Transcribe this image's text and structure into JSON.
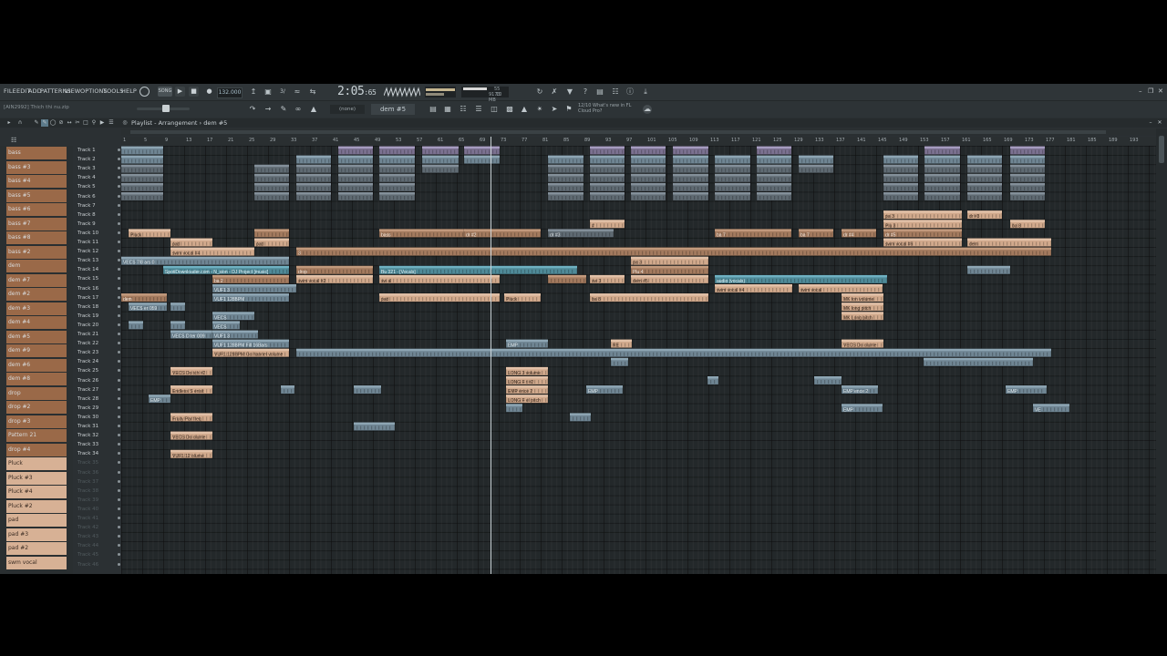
{
  "menu": [
    "FILE",
    "EDIT",
    "ADD",
    "PATTERNS",
    "VIEW",
    "OPTIONS",
    "TOOLS",
    "HELP"
  ],
  "transport": {
    "tempo": "132.000",
    "time_main": "2:05",
    "time_sub": ":65",
    "cpu_mem": "9173 MB",
    "cpu_val": "55",
    "cpu_poly": "10"
  },
  "toolbar": {
    "hint": "[AIN2992] Thich thi nu.zip",
    "snap": "(none)",
    "pattern": "dem #5",
    "news": "12/10  What's new in FL Cloud Pro?"
  },
  "playlist": {
    "title": "Playlist - Arrangement › dem #5",
    "bars": [
      "1",
      "5",
      "9",
      "13",
      "17",
      "21",
      "25",
      "29",
      "33",
      "37",
      "41",
      "45",
      "49",
      "53",
      "57",
      "61",
      "65",
      "69",
      "73",
      "77",
      "81",
      "85",
      "89",
      "93",
      "97",
      "101",
      "105",
      "109",
      "113",
      "117",
      "121",
      "125",
      "129",
      "133",
      "137",
      "141",
      "145",
      "149",
      "153",
      "157",
      "161",
      "165",
      "169",
      "173",
      "177",
      "181",
      "185",
      "189",
      "193"
    ]
  },
  "picker": [
    {
      "label": "bass",
      "c": "a"
    },
    {
      "label": "bass #3",
      "c": "a"
    },
    {
      "label": "bass #4",
      "c": "a"
    },
    {
      "label": "bass #5",
      "c": "a"
    },
    {
      "label": "bass #6",
      "c": "a"
    },
    {
      "label": "bass #7",
      "c": "a"
    },
    {
      "label": "bass #8",
      "c": "a"
    },
    {
      "label": "bass #2",
      "c": "a"
    },
    {
      "label": "dem",
      "c": "a"
    },
    {
      "label": "dem #7",
      "c": "a"
    },
    {
      "label": "dem #2",
      "c": "a"
    },
    {
      "label": "dem #3",
      "c": "a"
    },
    {
      "label": "dem #4",
      "c": "a"
    },
    {
      "label": "dem #5",
      "c": "a"
    },
    {
      "label": "dem #9",
      "c": "a"
    },
    {
      "label": "dem #6",
      "c": "a"
    },
    {
      "label": "dem #8",
      "c": "a"
    },
    {
      "label": "drop",
      "c": "a"
    },
    {
      "label": "drop #2",
      "c": "a"
    },
    {
      "label": "drop #3",
      "c": "a"
    },
    {
      "label": "Pattern 21",
      "c": "a"
    },
    {
      "label": "drop #4",
      "c": "a"
    },
    {
      "label": "Pluck",
      "c": "b"
    },
    {
      "label": "Pluck #3",
      "c": "b"
    },
    {
      "label": "Pluck #4",
      "c": "b"
    },
    {
      "label": "Pluck #2",
      "c": "b"
    },
    {
      "label": "pad",
      "c": "b"
    },
    {
      "label": "pad #3",
      "c": "b"
    },
    {
      "label": "pad #2",
      "c": "b"
    },
    {
      "label": "swm vocal",
      "c": "b"
    }
  ],
  "tracks": [
    "Track 1",
    "Track 2",
    "Track 3",
    "Track 4",
    "Track 5",
    "Track 6",
    "Track 7",
    "Track 8",
    "Track 9",
    "Track 10",
    "Track 11",
    "Track 12",
    "Track 13",
    "Track 14",
    "Track 15",
    "Track 16",
    "Track 17",
    "Track 18",
    "Track 19",
    "Track 20",
    "Track 21",
    "Track 22",
    "Track 23",
    "Track 24",
    "Track 25",
    "Track 26",
    "Track 27",
    "Track 28",
    "Track 29",
    "Track 30",
    "Track 31",
    "Track 32",
    "Track 33",
    "Track 34",
    "Track 35",
    "Track 36",
    "Track 37",
    "Track 38",
    "Track 39",
    "Track 40",
    "Track 41",
    "Track 42",
    "Track 43",
    "Track 44",
    "Track 45",
    "Track 46"
  ],
  "active_track_count": 34,
  "clips": [
    {
      "t": 0,
      "s": 0,
      "e": 46,
      "k": "blue"
    },
    {
      "t": 0,
      "s": 238,
      "e": 276,
      "k": "purple"
    },
    {
      "t": 0,
      "s": 283,
      "e": 322,
      "k": "purple"
    },
    {
      "t": 0,
      "s": 330,
      "e": 370,
      "k": "purple"
    },
    {
      "t": 0,
      "s": 376,
      "e": 415,
      "k": "purple"
    },
    {
      "t": 0,
      "s": 514,
      "e": 552,
      "k": "purple"
    },
    {
      "t": 0,
      "s": 559,
      "e": 597,
      "k": "purple"
    },
    {
      "t": 0,
      "s": 605,
      "e": 644,
      "k": "purple"
    },
    {
      "t": 0,
      "s": 697,
      "e": 735,
      "k": "purple"
    },
    {
      "t": 0,
      "s": 881,
      "e": 920,
      "k": "purple"
    },
    {
      "t": 0,
      "s": 975,
      "e": 1013,
      "k": "purple"
    },
    {
      "t": 1,
      "s": 0,
      "e": 46,
      "k": "blue"
    },
    {
      "t": 1,
      "s": 192,
      "e": 230,
      "k": "blue"
    },
    {
      "t": 1,
      "s": 238,
      "e": 276,
      "k": "blue"
    },
    {
      "t": 1,
      "s": 283,
      "e": 322,
      "k": "blue"
    },
    {
      "t": 1,
      "s": 330,
      "e": 370,
      "k": "blue"
    },
    {
      "t": 1,
      "s": 376,
      "e": 415,
      "k": "blue"
    },
    {
      "t": 1,
      "s": 468,
      "e": 507,
      "k": "blue"
    },
    {
      "t": 1,
      "s": 514,
      "e": 552,
      "k": "blue"
    },
    {
      "t": 1,
      "s": 559,
      "e": 597,
      "k": "blue"
    },
    {
      "t": 1,
      "s": 605,
      "e": 644,
      "k": "blue"
    },
    {
      "t": 1,
      "s": 651,
      "e": 690,
      "k": "blue"
    },
    {
      "t": 1,
      "s": 697,
      "e": 735,
      "k": "blue"
    },
    {
      "t": 1,
      "s": 743,
      "e": 781,
      "k": "blue"
    },
    {
      "t": 1,
      "s": 836,
      "e": 874,
      "k": "blue"
    },
    {
      "t": 1,
      "s": 881,
      "e": 920,
      "k": "blue"
    },
    {
      "t": 1,
      "s": 928,
      "e": 966,
      "k": "blue"
    },
    {
      "t": 1,
      "s": 975,
      "e": 1013,
      "k": "blue"
    },
    {
      "t": 2,
      "s": 0,
      "e": 46,
      "k": "grey"
    },
    {
      "t": 2,
      "s": 146,
      "e": 184,
      "k": "grey"
    },
    {
      "t": 2,
      "s": 192,
      "e": 230,
      "k": "grey"
    },
    {
      "t": 2,
      "s": 238,
      "e": 276,
      "k": "grey"
    },
    {
      "t": 2,
      "s": 283,
      "e": 322,
      "k": "grey"
    },
    {
      "t": 2,
      "s": 330,
      "e": 370,
      "k": "grey"
    },
    {
      "t": 2,
      "s": 468,
      "e": 507,
      "k": "grey"
    },
    {
      "t": 2,
      "s": 514,
      "e": 552,
      "k": "grey"
    },
    {
      "t": 2,
      "s": 559,
      "e": 597,
      "k": "grey"
    },
    {
      "t": 2,
      "s": 605,
      "e": 644,
      "k": "grey"
    },
    {
      "t": 2,
      "s": 651,
      "e": 690,
      "k": "grey"
    },
    {
      "t": 2,
      "s": 697,
      "e": 735,
      "k": "grey"
    },
    {
      "t": 2,
      "s": 743,
      "e": 781,
      "k": "grey"
    },
    {
      "t": 2,
      "s": 836,
      "e": 874,
      "k": "grey"
    },
    {
      "t": 2,
      "s": 881,
      "e": 920,
      "k": "grey"
    },
    {
      "t": 2,
      "s": 928,
      "e": 966,
      "k": "grey"
    },
    {
      "t": 2,
      "s": 975,
      "e": 1013,
      "k": "grey"
    },
    {
      "t": 3,
      "s": 0,
      "e": 46,
      "k": "grey"
    },
    {
      "t": 3,
      "s": 146,
      "e": 184,
      "k": "grey"
    },
    {
      "t": 3,
      "s": 192,
      "e": 230,
      "k": "grey"
    },
    {
      "t": 3,
      "s": 238,
      "e": 276,
      "k": "grey"
    },
    {
      "t": 3,
      "s": 283,
      "e": 322,
      "k": "grey"
    },
    {
      "t": 3,
      "s": 468,
      "e": 507,
      "k": "grey"
    },
    {
      "t": 3,
      "s": 514,
      "e": 552,
      "k": "grey"
    },
    {
      "t": 3,
      "s": 559,
      "e": 597,
      "k": "grey"
    },
    {
      "t": 3,
      "s": 605,
      "e": 644,
      "k": "grey"
    },
    {
      "t": 3,
      "s": 651,
      "e": 690,
      "k": "grey"
    },
    {
      "t": 3,
      "s": 697,
      "e": 735,
      "k": "grey"
    },
    {
      "t": 3,
      "s": 836,
      "e": 874,
      "k": "grey"
    },
    {
      "t": 3,
      "s": 881,
      "e": 920,
      "k": "grey"
    },
    {
      "t": 3,
      "s": 928,
      "e": 966,
      "k": "grey"
    },
    {
      "t": 3,
      "s": 975,
      "e": 1013,
      "k": "grey"
    },
    {
      "t": 4,
      "s": 0,
      "e": 46,
      "k": "grey"
    },
    {
      "t": 4,
      "s": 146,
      "e": 184,
      "k": "grey"
    },
    {
      "t": 4,
      "s": 192,
      "e": 230,
      "k": "grey"
    },
    {
      "t": 4,
      "s": 238,
      "e": 276,
      "k": "grey"
    },
    {
      "t": 4,
      "s": 283,
      "e": 322,
      "k": "grey"
    },
    {
      "t": 4,
      "s": 468,
      "e": 507,
      "k": "grey"
    },
    {
      "t": 4,
      "s": 514,
      "e": 552,
      "k": "grey"
    },
    {
      "t": 4,
      "s": 559,
      "e": 597,
      "k": "grey"
    },
    {
      "t": 4,
      "s": 605,
      "e": 644,
      "k": "grey"
    },
    {
      "t": 4,
      "s": 651,
      "e": 690,
      "k": "grey"
    },
    {
      "t": 4,
      "s": 697,
      "e": 735,
      "k": "grey"
    },
    {
      "t": 4,
      "s": 836,
      "e": 874,
      "k": "grey"
    },
    {
      "t": 4,
      "s": 881,
      "e": 920,
      "k": "grey"
    },
    {
      "t": 4,
      "s": 928,
      "e": 966,
      "k": "grey"
    },
    {
      "t": 4,
      "s": 975,
      "e": 1013,
      "k": "grey"
    },
    {
      "t": 5,
      "s": 0,
      "e": 46,
      "k": "grey"
    },
    {
      "t": 5,
      "s": 146,
      "e": 184,
      "k": "grey"
    },
    {
      "t": 5,
      "s": 192,
      "e": 230,
      "k": "grey"
    },
    {
      "t": 5,
      "s": 238,
      "e": 276,
      "k": "grey"
    },
    {
      "t": 5,
      "s": 283,
      "e": 322,
      "k": "grey"
    },
    {
      "t": 5,
      "s": 468,
      "e": 507,
      "k": "grey"
    },
    {
      "t": 5,
      "s": 514,
      "e": 552,
      "k": "grey"
    },
    {
      "t": 5,
      "s": 559,
      "e": 597,
      "k": "grey"
    },
    {
      "t": 5,
      "s": 605,
      "e": 644,
      "k": "grey"
    },
    {
      "t": 5,
      "s": 651,
      "e": 690,
      "k": "grey"
    },
    {
      "t": 5,
      "s": 697,
      "e": 735,
      "k": "grey"
    },
    {
      "t": 5,
      "s": 836,
      "e": 874,
      "k": "grey"
    },
    {
      "t": 5,
      "s": 881,
      "e": 920,
      "k": "grey"
    },
    {
      "t": 5,
      "s": 928,
      "e": 966,
      "k": "grey"
    },
    {
      "t": 5,
      "s": 975,
      "e": 1013,
      "k": "grey"
    },
    {
      "t": 7,
      "s": 836,
      "e": 922,
      "k": "peach",
      "n": "pa 3"
    },
    {
      "t": 7,
      "s": 928,
      "e": 966,
      "k": "peach",
      "n": "dr #3"
    },
    {
      "t": 8,
      "s": 514,
      "e": 552,
      "k": "peach",
      "n": "#"
    },
    {
      "t": 8,
      "s": 836,
      "e": 922,
      "k": "peach",
      "n": "Plu 3"
    },
    {
      "t": 8,
      "s": 975,
      "e": 1013,
      "k": "peach",
      "n": "ba 8"
    },
    {
      "t": 9,
      "s": 8,
      "e": 54,
      "k": "peach",
      "n": "Pluck"
    },
    {
      "t": 9,
      "s": 146,
      "e": 184,
      "k": "brown"
    },
    {
      "t": 9,
      "s": 283,
      "e": 378,
      "k": "brown",
      "n": "bass"
    },
    {
      "t": 9,
      "s": 376,
      "e": 460,
      "k": "brown",
      "n": "dr #2"
    },
    {
      "t": 9,
      "s": 468,
      "e": 540,
      "k": "grey",
      "n": "dr #3"
    },
    {
      "t": 9,
      "s": 651,
      "e": 735,
      "k": "brown",
      "n": "ba 7"
    },
    {
      "t": 9,
      "s": 743,
      "e": 781,
      "k": "brown",
      "n": "ba 7"
    },
    {
      "t": 9,
      "s": 790,
      "e": 828,
      "k": "brown",
      "n": "dr #4"
    },
    {
      "t": 9,
      "s": 836,
      "e": 922,
      "k": "brown",
      "n": "dr #5"
    },
    {
      "t": 10,
      "s": 54,
      "e": 100,
      "k": "peach",
      "n": "pad"
    },
    {
      "t": 10,
      "s": 146,
      "e": 184,
      "k": "peach",
      "n": "pad"
    },
    {
      "t": 10,
      "s": 836,
      "e": 922,
      "k": "peach",
      "n": "swm vocal #6"
    },
    {
      "t": 10,
      "s": 928,
      "e": 1020,
      "k": "peach",
      "n": "dem"
    },
    {
      "t": 11,
      "s": 54,
      "e": 146,
      "k": "peach",
      "n": "swm vocal #4"
    },
    {
      "t": 11,
      "s": 192,
      "e": 1020,
      "k": "brown",
      "n": "3"
    },
    {
      "t": 12,
      "s": 0,
      "e": 184,
      "k": "blue",
      "n": "VECS 7/8 ars 0"
    },
    {
      "t": 12,
      "s": 559,
      "e": 644,
      "k": "peach",
      "n": "pa 3"
    },
    {
      "t": 13,
      "s": 46,
      "e": 184,
      "k": "teal",
      "n": "SpotiDownloader.com - N_sion - DJ Project [music]"
    },
    {
      "t": 13,
      "s": 192,
      "e": 276,
      "k": "brown",
      "n": "drop"
    },
    {
      "t": 13,
      "s": 283,
      "e": 500,
      "k": "teal",
      "n": "Bu 321 - [Vocals]"
    },
    {
      "t": 13,
      "s": 559,
      "e": 644,
      "k": "brown",
      "n": "Plu 4"
    },
    {
      "t": 13,
      "s": 928,
      "e": 975,
      "k": "blue"
    },
    {
      "t": 14,
      "s": 100,
      "e": 184,
      "k": "brown",
      "n": "ba 2"
    },
    {
      "t": 14,
      "s": 192,
      "e": 276,
      "k": "peach",
      "n": "swm vocal #2"
    },
    {
      "t": 14,
      "s": 283,
      "e": 415,
      "k": "peach",
      "n": "sw al"
    },
    {
      "t": 14,
      "s": 468,
      "e": 510,
      "k": "brown"
    },
    {
      "t": 14,
      "s": 514,
      "e": 552,
      "k": "peach",
      "n": "sw 3"
    },
    {
      "t": 14,
      "s": 559,
      "e": 644,
      "k": "peach",
      "n": "dem #5"
    },
    {
      "t": 14,
      "s": 651,
      "e": 840,
      "k": "teal",
      "n": "audio (vocals)"
    },
    {
      "t": 15,
      "s": 100,
      "e": 192,
      "k": "blue",
      "n": "VUF1 3"
    },
    {
      "t": 15,
      "s": 651,
      "e": 736,
      "k": "peach",
      "n": "swm vocal #4"
    },
    {
      "t": 15,
      "s": 743,
      "e": 835,
      "k": "peach",
      "n": "swm vocal"
    },
    {
      "t": 16,
      "s": 0,
      "e": 50,
      "k": "brown",
      "n": "dem"
    },
    {
      "t": 16,
      "s": 100,
      "e": 184,
      "k": "blue",
      "n": "VUF1 128BPM"
    },
    {
      "t": 16,
      "s": 283,
      "e": 415,
      "k": "peach",
      "n": "pad"
    },
    {
      "t": 16,
      "s": 420,
      "e": 460,
      "k": "peach",
      "n": "Pluck"
    },
    {
      "t": 16,
      "s": 514,
      "e": 644,
      "k": "peach",
      "n": "ba 8"
    },
    {
      "t": 16,
      "s": 790,
      "e": 836,
      "k": "peach",
      "n": "MK ton volume"
    },
    {
      "t": 17,
      "s": 8,
      "e": 50,
      "k": "blue",
      "n": "VECS er 059"
    },
    {
      "t": 17,
      "s": 54,
      "e": 70,
      "k": "blue"
    },
    {
      "t": 17,
      "s": 790,
      "e": 836,
      "k": "peach",
      "n": "MK long pitch"
    },
    {
      "t": 18,
      "s": 100,
      "e": 146,
      "k": "blue",
      "n": "VECS"
    },
    {
      "t": 18,
      "s": 790,
      "e": 836,
      "k": "peach",
      "n": "MK Long pitch"
    },
    {
      "t": 19,
      "s": 8,
      "e": 24,
      "k": "blue"
    },
    {
      "t": 19,
      "s": 54,
      "e": 70,
      "k": "blue"
    },
    {
      "t": 19,
      "s": 100,
      "e": 130,
      "k": "blue",
      "n": "VECS"
    },
    {
      "t": 20,
      "s": 54,
      "e": 100,
      "k": "blue",
      "n": "VECS D ter 009"
    },
    {
      "t": 20,
      "s": 100,
      "e": 150,
      "k": "blue",
      "n": "VUF1 3"
    },
    {
      "t": 21,
      "s": 100,
      "e": 184,
      "k": "blue",
      "n": "VUF1 128BPM Fill 16Bars"
    },
    {
      "t": 21,
      "s": 422,
      "e": 468,
      "k": "blue",
      "n": "EMP"
    },
    {
      "t": 21,
      "s": 537,
      "e": 560,
      "k": "peach",
      "n": "RE"
    },
    {
      "t": 21,
      "s": 790,
      "e": 836,
      "k": "peach",
      "n": "VECS Do olume"
    },
    {
      "t": 22,
      "s": 100,
      "e": 184,
      "k": "peach",
      "n": "VUF1 128BPM Go hannel volume"
    },
    {
      "t": 22,
      "s": 192,
      "e": 1020,
      "k": "blue"
    },
    {
      "t": 23,
      "s": 537,
      "e": 556,
      "k": "blue"
    },
    {
      "t": 23,
      "s": 880,
      "e": 1000,
      "k": "blue"
    },
    {
      "t": 24,
      "s": 54,
      "e": 100,
      "k": "peach",
      "n": "VECS Do tch #2"
    },
    {
      "t": 24,
      "s": 422,
      "e": 468,
      "k": "peach",
      "n": "LONG 3 volume"
    },
    {
      "t": 25,
      "s": 422,
      "e": 468,
      "k": "peach",
      "n": "LONG F t #2"
    },
    {
      "t": 25,
      "s": 643,
      "e": 655,
      "k": "blue"
    },
    {
      "t": 25,
      "s": 760,
      "e": 790,
      "k": "blue"
    },
    {
      "t": 26,
      "s": 54,
      "e": 100,
      "k": "peach",
      "n": "Endless S ensit"
    },
    {
      "t": 26,
      "s": 175,
      "e": 190,
      "k": "blue"
    },
    {
      "t": 26,
      "s": 255,
      "e": 285,
      "k": "blue"
    },
    {
      "t": 26,
      "s": 422,
      "e": 468,
      "k": "peach",
      "n": "EMP ence 2"
    },
    {
      "t": 26,
      "s": 510,
      "e": 550,
      "k": "blue",
      "n": "EMP"
    },
    {
      "t": 26,
      "s": 790,
      "e": 830,
      "k": "blue",
      "n": "EMP ence 2"
    },
    {
      "t": 26,
      "s": 970,
      "e": 1015,
      "k": "blue",
      "n": "EMP"
    },
    {
      "t": 27,
      "s": 30,
      "e": 54,
      "k": "blue",
      "n": "EMP"
    },
    {
      "t": 27,
      "s": 422,
      "e": 468,
      "k": "peach",
      "n": "LONG F el pitch"
    },
    {
      "t": 28,
      "s": 422,
      "e": 440,
      "k": "blue"
    },
    {
      "t": 28,
      "s": 790,
      "e": 835,
      "k": "blue",
      "n": "EMP"
    },
    {
      "t": 28,
      "s": 1000,
      "e": 1040,
      "k": "blue",
      "n": "VE"
    },
    {
      "t": 29,
      "s": 54,
      "e": 100,
      "k": "peach",
      "n": "Fruity Par freq"
    },
    {
      "t": 29,
      "s": 492,
      "e": 515,
      "k": "blue"
    },
    {
      "t": 30,
      "s": 255,
      "e": 300,
      "k": "blue"
    },
    {
      "t": 31,
      "s": 54,
      "e": 100,
      "k": "peach",
      "n": "VECS Do olume"
    },
    {
      "t": 33,
      "s": 54,
      "e": 100,
      "k": "peach",
      "n": "VUF1 12 olume"
    }
  ]
}
